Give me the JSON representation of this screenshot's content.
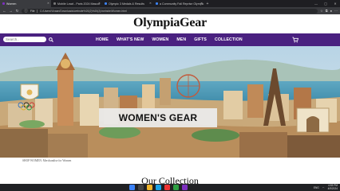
{
  "browser": {
    "tabs": [
      {
        "title": "Women",
        "active": true
      },
      {
        "title": "Mobile Lowd - Paris 2024 Mascot",
        "active": false
      },
      {
        "title": "Olympic 3 Medals & Results",
        "active": false
      },
      {
        "title": "a Community Fall Reprise Olympic",
        "active": false
      }
    ],
    "address_label": "File",
    "url": "C:/Users/Vivaan/Downloads/website%20(2)%20(2)/website/Women.html"
  },
  "site": {
    "brand": "OlympiaGear",
    "search_placeholder": "Search..",
    "menu": [
      "HOME",
      "WHAT'S NEW",
      "WOMEN",
      "MEN",
      "GIFTS",
      "COLLECTION"
    ],
    "hero_title": "WOMEN'S GEAR",
    "breadcrumb": "SHOP WOMEN: Merchandise for Women",
    "section_title": "Our Collection"
  },
  "taskbar": {
    "time": "4:53 PM",
    "date": "4/9/2024",
    "lang": "ENG"
  },
  "colors": {
    "navbar": "#4a2180",
    "accent": "#7d2fbf"
  }
}
